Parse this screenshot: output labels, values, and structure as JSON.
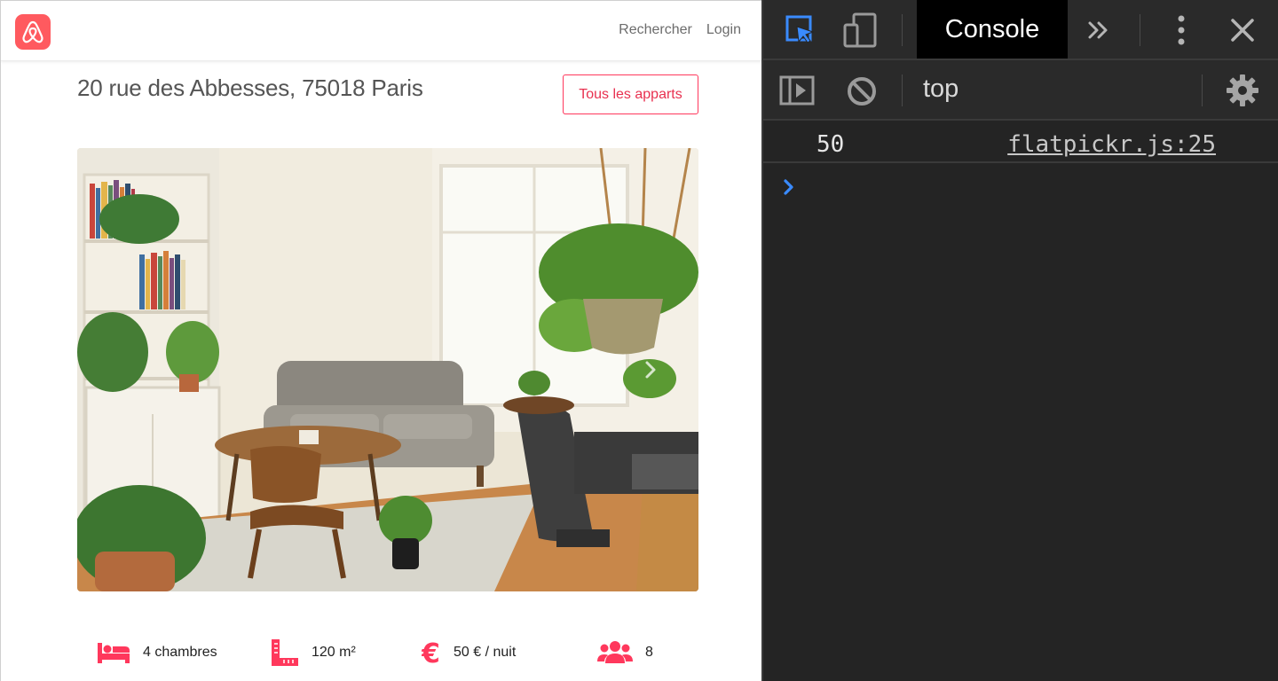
{
  "page": {
    "nav": {
      "search": "Rechercher",
      "login": "Login"
    },
    "title": "20 rue des Abbesses, 75018 Paris",
    "all_button": "Tous les apparts",
    "features": {
      "rooms": "4 chambres",
      "area": "120 m²",
      "price": "50 € / nuit",
      "guests": "8"
    }
  },
  "devtools": {
    "console_tab": "Console",
    "context": "top",
    "log": {
      "value": "50",
      "source": "flatpickr.js:25"
    }
  },
  "colors": {
    "brand": "#ff5a5f",
    "accent": "#ff385c",
    "devtools_bg": "#242424",
    "prompt_blue": "#3a8bff"
  }
}
